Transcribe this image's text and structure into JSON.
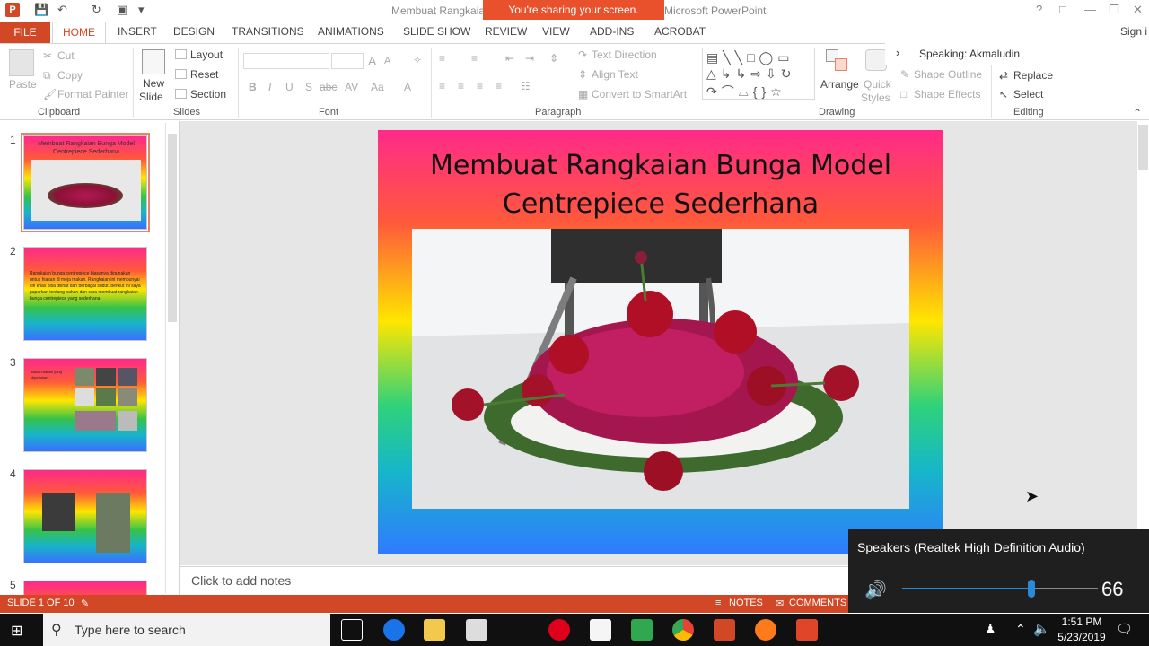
{
  "window": {
    "title_left": "Membuat Rangkaian",
    "title_right": "Microsoft PowerPoint",
    "share_banner": "You're sharing your screen.",
    "help_glyph": "?",
    "sign_in": "Sign i"
  },
  "tabs": [
    "FILE",
    "HOME",
    "INSERT",
    "DESIGN",
    "TRANSITIONS",
    "ANIMATIONS",
    "SLIDE SHOW",
    "REVIEW",
    "VIEW",
    "ADD-INS",
    "ACROBAT"
  ],
  "ribbon": {
    "clipboard": {
      "paste": "Paste",
      "cut": "Cut",
      "copy": "Copy",
      "format_painter": "Format Painter",
      "label": "Clipboard"
    },
    "slides": {
      "new_slide": "New",
      "new_slide_2": "Slide",
      "layout": "Layout",
      "reset": "Reset",
      "section": "Section",
      "label": "Slides"
    },
    "font": {
      "bold": "B",
      "italic": "I",
      "underline": "U",
      "shadow": "S",
      "strike": "abc",
      "spacing": "AV",
      "case": "Aa",
      "color": "A",
      "grow": "A",
      "shrink": "A",
      "label": "Font"
    },
    "paragraph": {
      "text_direction": "Text Direction",
      "align_text": "Align Text",
      "convert": "Convert to SmartArt",
      "label": "Paragraph"
    },
    "drawing": {
      "arrange": "Arrange",
      "quick_styles": "Quick",
      "quick_styles_2": "Styles",
      "shape_outline": "Shape Outline",
      "shape_effects": "Shape Effects",
      "label": "Drawing"
    },
    "editing": {
      "replace": "Replace",
      "select": "Select",
      "label": "Editing"
    }
  },
  "speaking": "Speaking: Akmaludin",
  "thumbnails": [
    {
      "num": "1",
      "title": "Membuat Rangkaian Bunga Model Centrepiece Sederhana"
    },
    {
      "num": "2",
      "text": "Rangkaian bunga centrepiece biasanya digunakan untuk hiasan di meja makan. Rangkaian ini mempunyai ciri khas bisa dilihat dari berbagai sudut. berikut ini saya paparkan tentang bahan dan cara membuat rangkaian bunga centrepiece yang sederhana"
    },
    {
      "num": "3",
      "text": "Bahan-bahan yang diperlukan:"
    },
    {
      "num": "4",
      "text": ""
    },
    {
      "num": "5",
      "text": ""
    }
  ],
  "slide": {
    "title_line1": "Membuat Rangkaian Bunga Model",
    "title_line2": "Centrepiece Sederhana"
  },
  "notes_placeholder": "Click to add notes",
  "status": {
    "slide_of": "SLIDE 1 OF 10",
    "notes": "NOTES",
    "comments": "COMMENTS"
  },
  "speaker_flyout": {
    "device": "Speakers (Realtek High Definition Audio)",
    "volume": 66
  },
  "taskbar": {
    "search_placeholder": "Type here to search",
    "time": "1:51 PM",
    "date": "5/23/2019"
  }
}
